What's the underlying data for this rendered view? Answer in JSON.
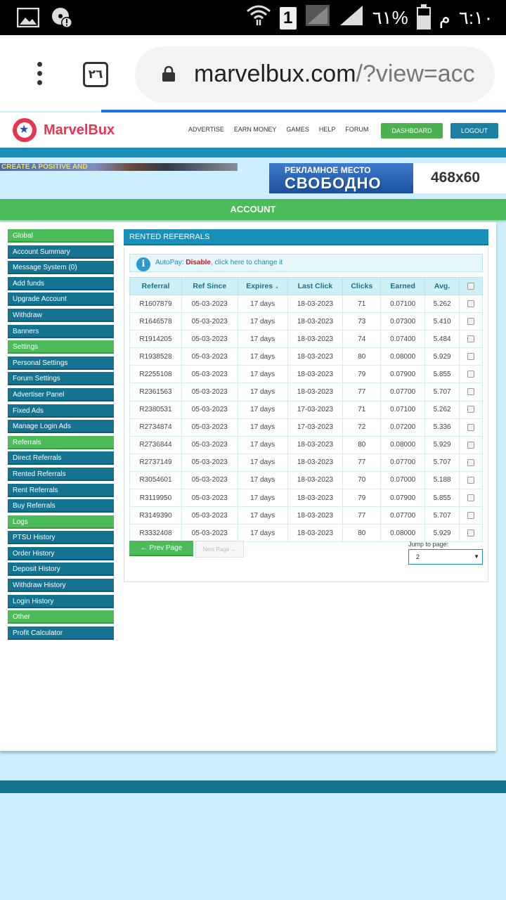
{
  "status_bar": {
    "time": "٦:١٠",
    "am_pm": "م",
    "battery_percent": "٦١%",
    "sim_slot": "1",
    "battery_level": 0.61
  },
  "browser": {
    "tab_count": "٢٦",
    "url_host": "marvelbux.com",
    "url_rest": "/?view=acc"
  },
  "site": {
    "brand": "MarvelBux",
    "nav": [
      "ADVERTISE",
      "EARN MONEY",
      "GAMES",
      "HELP",
      "FORUM"
    ],
    "dashboard_label": "DASHBOARD",
    "logout_label": "LOGOUT",
    "banner_left_text": "CREATE A POSITIVE AND",
    "banner_right_line1": "РЕКЛАМНОЕ МЕСТО",
    "banner_right_line2": "СВОБОДНО",
    "banner_right_size": "468x60",
    "account_label": "ACCOUNT"
  },
  "sidebar": [
    {
      "label": "Global",
      "section": true
    },
    {
      "label": "Account Summary",
      "section": false
    },
    {
      "label": "Message System (0)",
      "section": false
    },
    {
      "label": "Add funds",
      "section": false
    },
    {
      "label": "Upgrade Account",
      "section": false
    },
    {
      "label": "Withdraw",
      "section": false
    },
    {
      "label": "Banners",
      "section": false
    },
    {
      "label": "Settings",
      "section": true
    },
    {
      "label": "Personal Settings",
      "section": false
    },
    {
      "label": "Forum Settings",
      "section": false
    },
    {
      "label": "Advertiser Panel",
      "section": false
    },
    {
      "label": "Fixed Ads",
      "section": false
    },
    {
      "label": "Manage Login Ads",
      "section": false
    },
    {
      "label": "Referrals",
      "section": true
    },
    {
      "label": "Direct Referrals",
      "section": false
    },
    {
      "label": "Rented Referrals",
      "section": false
    },
    {
      "label": "Rent Referrals",
      "section": false
    },
    {
      "label": "Buy Referrals",
      "section": false
    },
    {
      "label": "Logs",
      "section": true
    },
    {
      "label": "PTSU History",
      "section": false
    },
    {
      "label": "Order History",
      "section": false
    },
    {
      "label": "Deposit History",
      "section": false
    },
    {
      "label": "Withdraw History",
      "section": false
    },
    {
      "label": "Login History",
      "section": false
    },
    {
      "label": "Other",
      "section": true
    },
    {
      "label": "Profit Calculator",
      "section": false
    }
  ],
  "content": {
    "title": "RENTED REFERRALS",
    "autopay_label": "AutoPay: ",
    "autopay_state": "Disable",
    "autopay_link": ", click here to change it",
    "columns": [
      "Referral",
      "Ref Since",
      "Expires",
      "Last Click",
      "Clicks",
      "Earned",
      "Avg."
    ],
    "rows": [
      [
        "R1607879",
        "05-03-2023",
        "17 days",
        "18-03-2023",
        "71",
        "0.07100",
        "5.262"
      ],
      [
        "R1646578",
        "05-03-2023",
        "17 days",
        "18-03-2023",
        "73",
        "0.07300",
        "5.410"
      ],
      [
        "R1914205",
        "05-03-2023",
        "17 days",
        "18-03-2023",
        "74",
        "0.07400",
        "5.484"
      ],
      [
        "R1938528",
        "05-03-2023",
        "17 days",
        "18-03-2023",
        "80",
        "0.08000",
        "5.929"
      ],
      [
        "R2255108",
        "05-03-2023",
        "17 days",
        "18-03-2023",
        "79",
        "0.07900",
        "5.855"
      ],
      [
        "R2361563",
        "05-03-2023",
        "17 days",
        "18-03-2023",
        "77",
        "0.07700",
        "5.707"
      ],
      [
        "R2380531",
        "05-03-2023",
        "17 days",
        "17-03-2023",
        "71",
        "0.07100",
        "5.262"
      ],
      [
        "R2734874",
        "05-03-2023",
        "17 days",
        "17-03-2023",
        "72",
        "0.07200",
        "5.336"
      ],
      [
        "R2736844",
        "05-03-2023",
        "17 days",
        "18-03-2023",
        "80",
        "0.08000",
        "5.929"
      ],
      [
        "R2737149",
        "05-03-2023",
        "17 days",
        "18-03-2023",
        "77",
        "0.07700",
        "5.707"
      ],
      [
        "R3054601",
        "05-03-2023",
        "17 days",
        "18-03-2023",
        "70",
        "0.07000",
        "5.188"
      ],
      [
        "R3119950",
        "05-03-2023",
        "17 days",
        "18-03-2023",
        "79",
        "0.07900",
        "5.855"
      ],
      [
        "R3149390",
        "05-03-2023",
        "17 days",
        "18-03-2023",
        "77",
        "0.07700",
        "5.707"
      ],
      [
        "R3332408",
        "05-03-2023",
        "17 days",
        "18-03-2023",
        "80",
        "0.08000",
        "5.929"
      ]
    ],
    "prev_label": "← Prev Page",
    "next_label": "Next Page →",
    "jump_label": "Jump to page:",
    "jump_value": "2"
  },
  "colors": {
    "teal": "#137391",
    "green": "#4cbb5a",
    "background": "#cdeefc",
    "brand": "#e8344f"
  }
}
